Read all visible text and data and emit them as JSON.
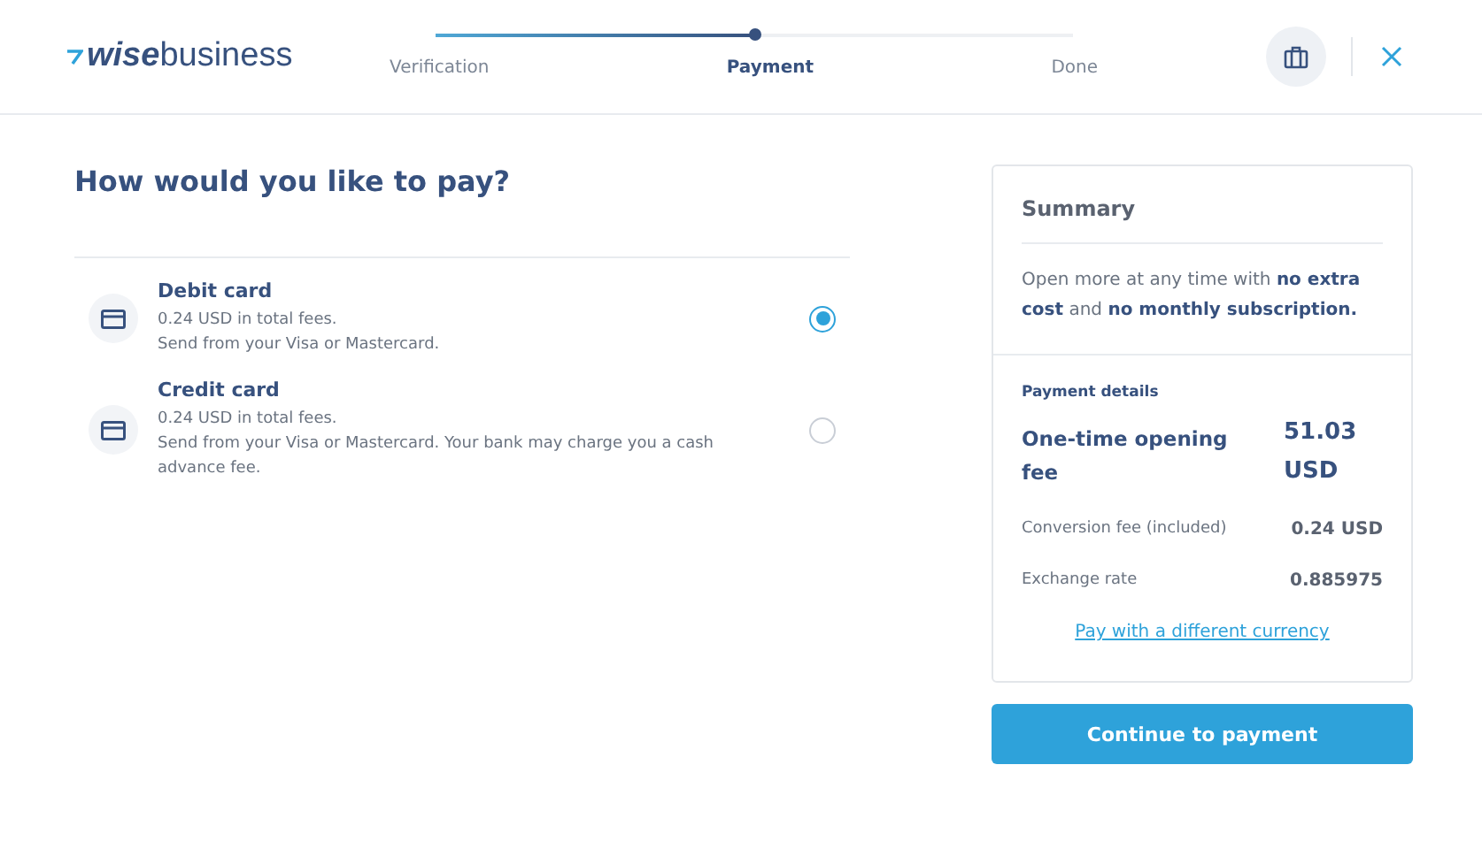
{
  "header": {
    "logo": "**wise**business",
    "steps": [
      {
        "label": "Verification",
        "selected": false
      },
      {
        "label": "Payment",
        "selected": true
      },
      {
        "label": "Done",
        "selected": false
      }
    ]
  },
  "title": "How would you like to pay?",
  "options": [
    {
      "name": "Debit card",
      "lines": [
        "0.24 USD in total fees.",
        "Send from your Visa or Mastercard."
      ],
      "selected": true
    },
    {
      "name": "Credit card",
      "lines": [
        "0.24 USD in total fees.",
        "Send from your Visa or Mastercard. Your bank may charge you a cash advance fee."
      ],
      "selected": false
    }
  ],
  "summary": {
    "title": "Summary",
    "note": "Open more at any time with **no extra cost** and **no monthly subscription.**",
    "details_title": "Payment details",
    "main_label": "One-time opening fee",
    "main_value": "51.03 USD",
    "rows": [
      {
        "label": "Conversion fee (included)",
        "value": "0.24 USD"
      },
      {
        "label": "Exchange rate",
        "value": "0.885975"
      }
    ],
    "link": "Pay with a different currency"
  },
  "button": "Continue to payment"
}
